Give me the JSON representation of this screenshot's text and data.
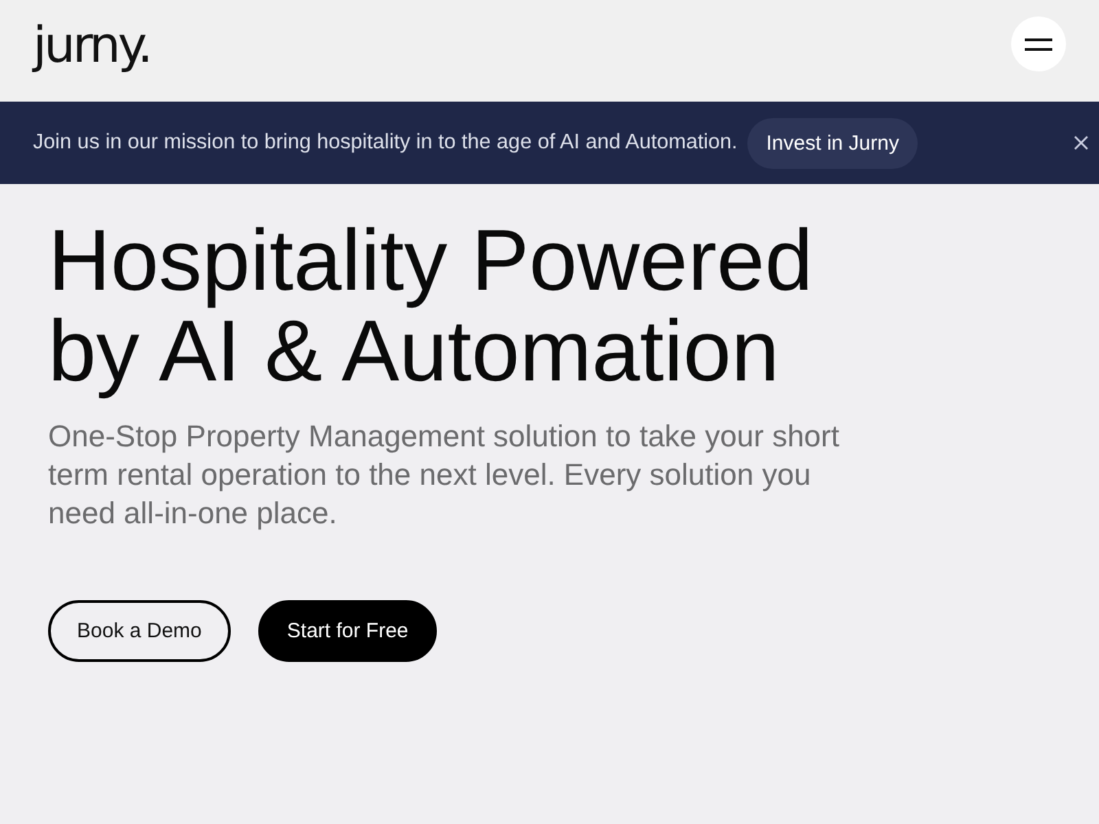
{
  "header": {
    "logo": "jurny."
  },
  "banner": {
    "message": "Join us in our mission to bring hospitality in to the age of AI and Automation.",
    "button": "Invest in Jurny"
  },
  "hero": {
    "title": "Hospitality Powered by AI & Automation",
    "subtitle": "One-Stop Property Management solution to take your short term rental operation to the next level. Every solution you need all-in-one place.",
    "buttons": [
      {
        "label": "Book a Demo",
        "kind": "outline"
      },
      {
        "label": "Start for Free",
        "kind": "filled"
      }
    ]
  }
}
